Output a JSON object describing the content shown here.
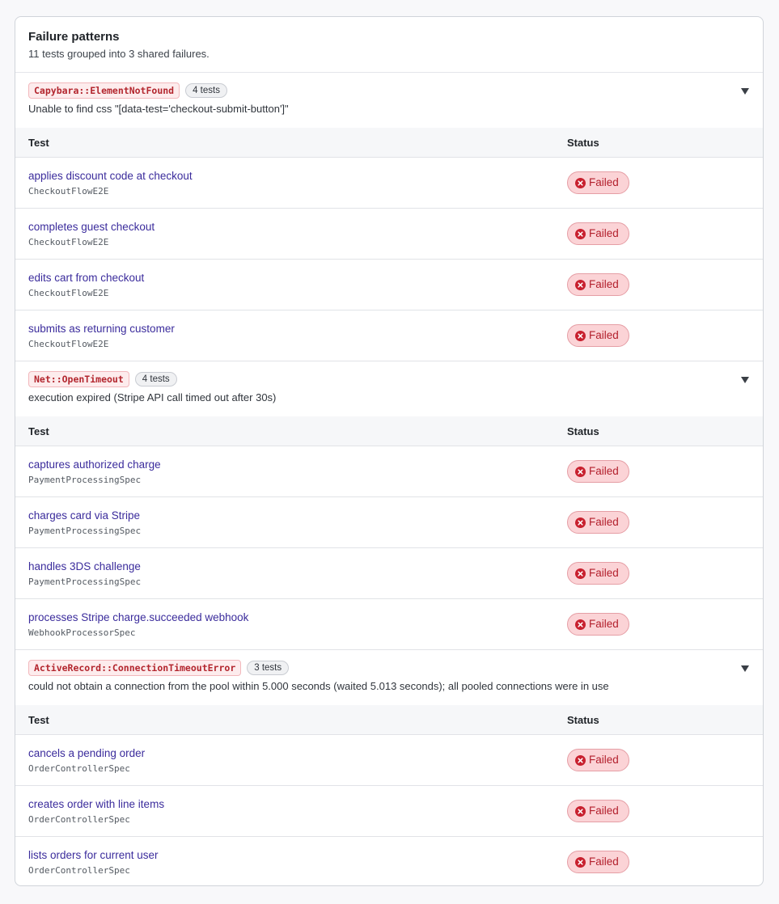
{
  "header": {
    "title": "Failure patterns",
    "subtitle": "11 tests grouped into 3 shared failures."
  },
  "table_headers": {
    "test": "Test",
    "status": "Status"
  },
  "icons": {
    "collapse": "chevron-down-icon",
    "status": "x-circle-icon"
  },
  "colors": {
    "link": "#3b2c9c",
    "error_text": "#b3262e",
    "failed_bg": "#fbd3d6"
  },
  "groups": [
    {
      "code": "Capybara::ElementNotFound",
      "count": "4 tests",
      "message": "Unable to find css \"[data-test='checkout-submit-button']\"",
      "tests": [
        {
          "name": "applies discount code at checkout",
          "spec": "CheckoutFlowE2E",
          "status": "Failed"
        },
        {
          "name": "completes guest checkout",
          "spec": "CheckoutFlowE2E",
          "status": "Failed"
        },
        {
          "name": "edits cart from checkout",
          "spec": "CheckoutFlowE2E",
          "status": "Failed"
        },
        {
          "name": "submits as returning customer",
          "spec": "CheckoutFlowE2E",
          "status": "Failed"
        }
      ]
    },
    {
      "code": "Net::OpenTimeout",
      "count": "4 tests",
      "message": "execution expired (Stripe API call timed out after 30s)",
      "tests": [
        {
          "name": "captures authorized charge",
          "spec": "PaymentProcessingSpec",
          "status": "Failed"
        },
        {
          "name": "charges card via Stripe",
          "spec": "PaymentProcessingSpec",
          "status": "Failed"
        },
        {
          "name": "handles 3DS challenge",
          "spec": "PaymentProcessingSpec",
          "status": "Failed"
        },
        {
          "name": "processes Stripe charge.succeeded webhook",
          "spec": "WebhookProcessorSpec",
          "status": "Failed"
        }
      ]
    },
    {
      "code": "ActiveRecord::ConnectionTimeoutError",
      "count": "3 tests",
      "message": "could not obtain a connection from the pool within 5.000 seconds (waited 5.013 seconds); all pooled connections were in use",
      "tests": [
        {
          "name": "cancels a pending order",
          "spec": "OrderControllerSpec",
          "status": "Failed"
        },
        {
          "name": "creates order with line items",
          "spec": "OrderControllerSpec",
          "status": "Failed"
        },
        {
          "name": "lists orders for current user",
          "spec": "OrderControllerSpec",
          "status": "Failed"
        }
      ]
    }
  ]
}
